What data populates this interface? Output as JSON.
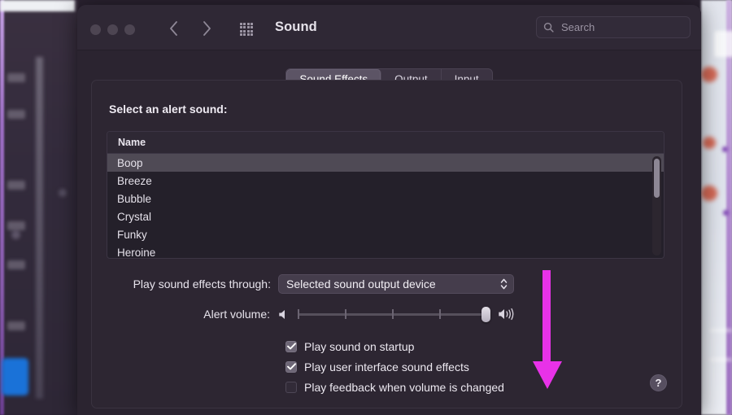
{
  "window": {
    "title": "Sound",
    "traffic_lights": [
      "close-button",
      "minimize-button",
      "zoom-button"
    ],
    "back_icon": "chevron-left-icon",
    "forward_icon": "chevron-right-icon",
    "grid_icon": "grid-apps-icon"
  },
  "search": {
    "placeholder": "Search",
    "value": "",
    "icon": "search-icon"
  },
  "tabs": [
    {
      "label": "Sound Effects",
      "active": true
    },
    {
      "label": "Output",
      "active": false
    },
    {
      "label": "Input",
      "active": false
    }
  ],
  "main": {
    "select_label": "Select an alert sound:",
    "table": {
      "column_header": "Name",
      "rows": [
        {
          "name": "Boop",
          "selected": true
        },
        {
          "name": "Breeze",
          "selected": false
        },
        {
          "name": "Bubble",
          "selected": false
        },
        {
          "name": "Crystal",
          "selected": false
        },
        {
          "name": "Funky",
          "selected": false
        },
        {
          "name": "Heroine",
          "selected": false
        }
      ],
      "scrollbar": {
        "thumb_position": "top"
      }
    },
    "output_row": {
      "label": "Play sound effects through:",
      "selected_value": "Selected sound output device",
      "chevron_icon": "chevron-up-down-icon"
    },
    "volume_row": {
      "label": "Alert volume:",
      "min_icon": "speaker-low-icon",
      "max_icon": "speaker-high-icon",
      "value_percent": 97,
      "tick_count": 5
    },
    "checkboxes": [
      {
        "label": "Play sound on startup",
        "checked": true
      },
      {
        "label": "Play user interface sound effects",
        "checked": true
      },
      {
        "label": "Play feedback when volume is changed",
        "checked": false
      }
    ],
    "help_button": {
      "label": "?"
    }
  },
  "annotation": {
    "arrow_color": "#e832e8",
    "direction": "down"
  }
}
